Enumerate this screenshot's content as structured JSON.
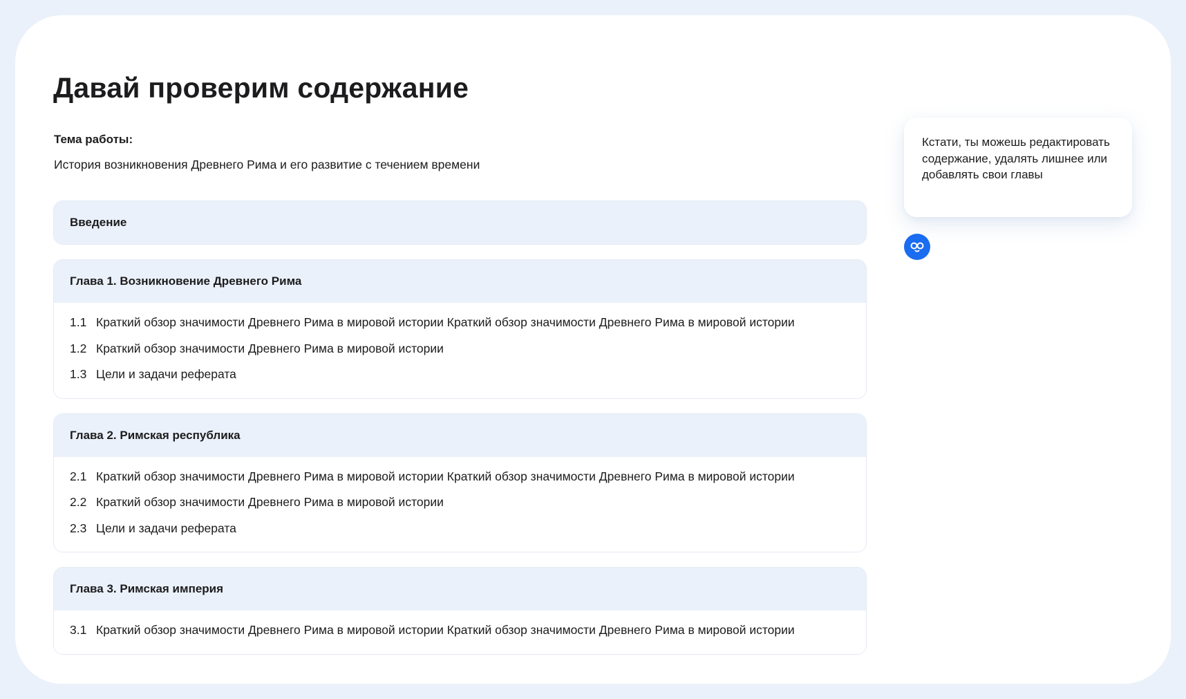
{
  "page": {
    "title": "Давай проверим содержание",
    "topic_label": "Тема работы:",
    "topic_value": "История возникновения Древнего Рима и его развитие с течением времени"
  },
  "toc": {
    "intro": "Введение",
    "chapters": [
      {
        "title": "Глава 1. Возникновение Древнего Рима",
        "items": [
          {
            "num": "1.1",
            "text": "Краткий обзор значимости Древнего Рима в мировой истории Краткий обзор значимости Древнего Рима в мировой истории"
          },
          {
            "num": "1.2",
            "text": "Краткий обзор значимости Древнего Рима в мировой истории"
          },
          {
            "num": "1.3",
            "text": "Цели и задачи реферата"
          }
        ]
      },
      {
        "title": "Глава 2. Римская республика",
        "items": [
          {
            "num": "2.1",
            "text": "Краткий обзор значимости Древнего Рима в мировой истории Краткий обзор значимости Древнего Рима в мировой истории"
          },
          {
            "num": "2.2",
            "text": "Краткий обзор значимости Древнего Рима в мировой истории"
          },
          {
            "num": "2.3",
            "text": "Цели и задачи реферата"
          }
        ]
      },
      {
        "title": "Глава 3. Римская империя",
        "items": [
          {
            "num": "3.1",
            "text": "Краткий обзор значимости Древнего Рима в мировой истории Краткий обзор значимости Древнего Рима в мировой истории"
          }
        ]
      }
    ]
  },
  "assistant": {
    "tip": "Кстати, ты можешь редактировать содержание, удалять лишнее или добавлять свои главы",
    "avatar_icon": "assistant-logo-icon",
    "avatar_color": "#1a6cf0"
  },
  "colors": {
    "background": "#ebf1fa",
    "card_header": "#ebf1fa",
    "accent": "#1a6cf0"
  }
}
